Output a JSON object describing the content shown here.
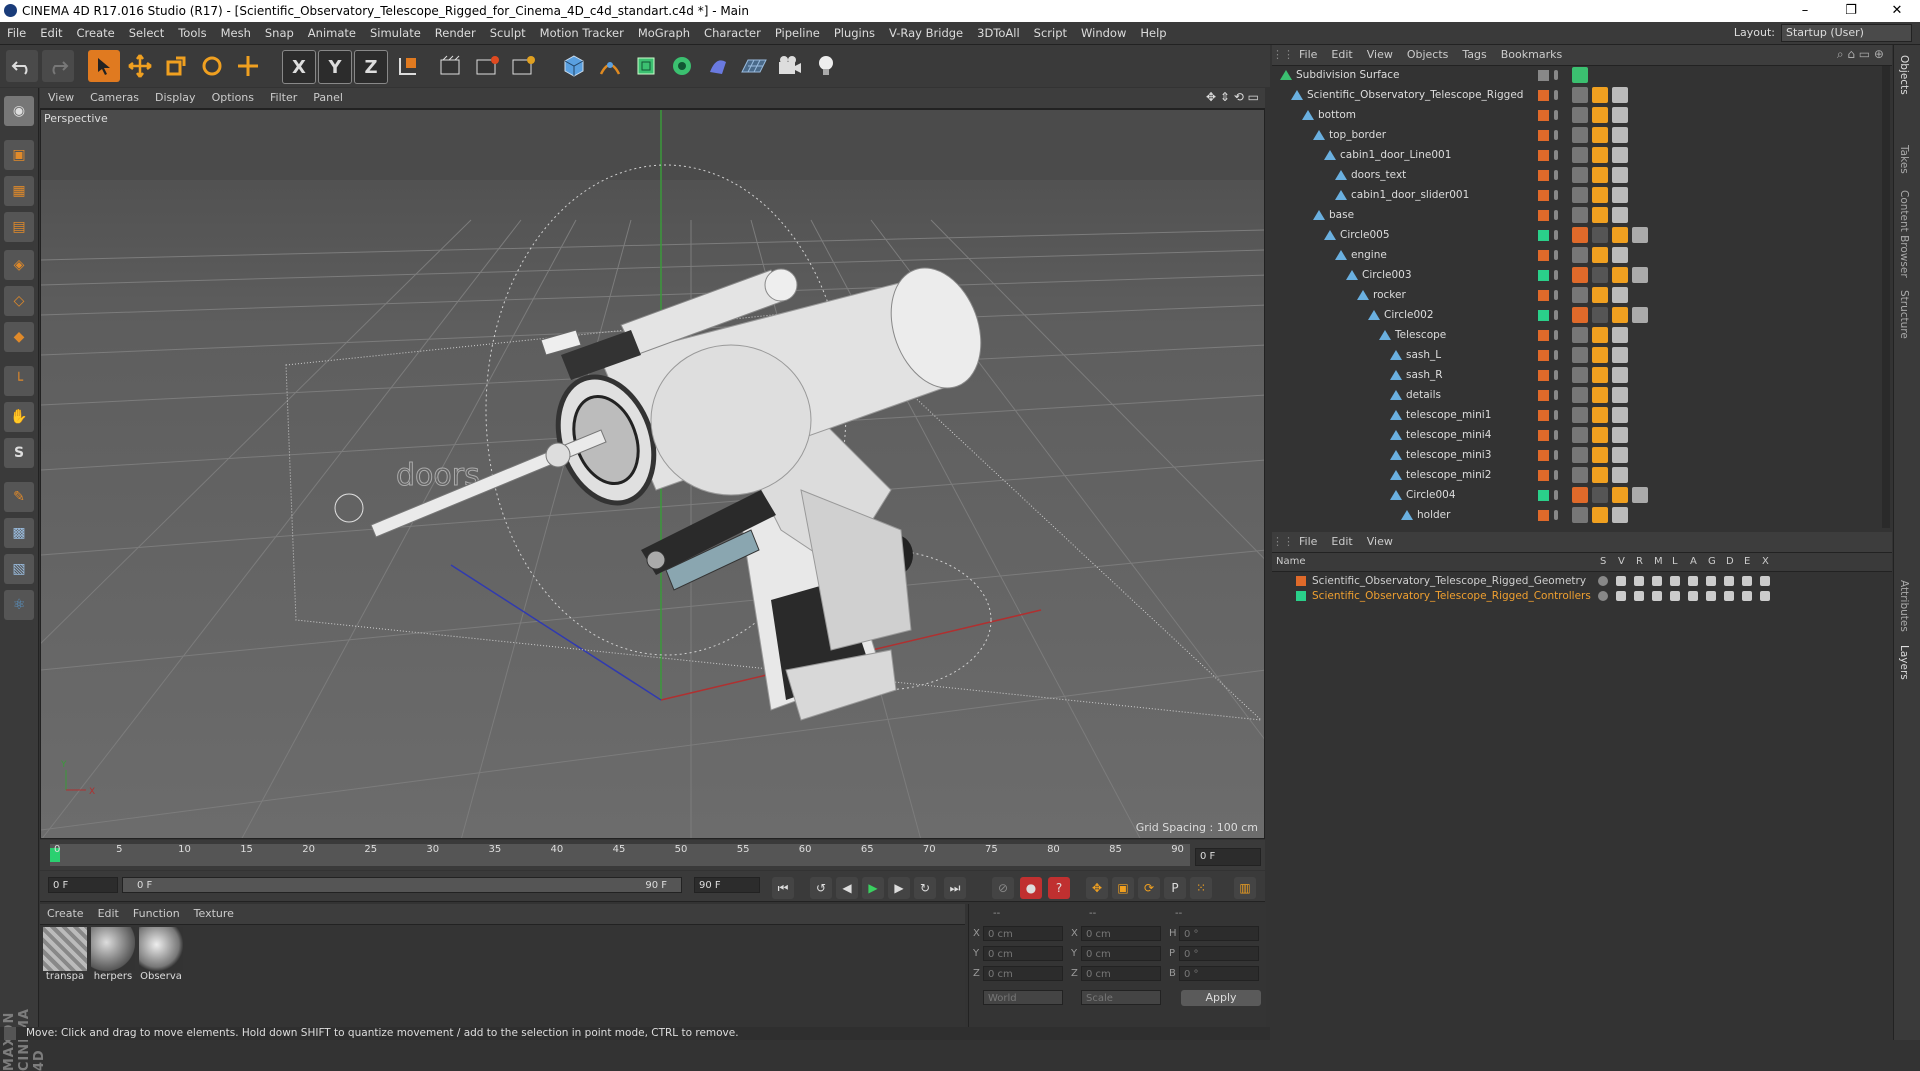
{
  "window": {
    "title": "CINEMA 4D R17.016 Studio (R17) - [Scientific_Observatory_Telescope_Rigged_for_Cinema_4D_c4d_standart.c4d *] - Main",
    "controls": [
      "–",
      "❐",
      "✕"
    ]
  },
  "menubar": {
    "items": [
      "File",
      "Edit",
      "Create",
      "Select",
      "Tools",
      "Mesh",
      "Snap",
      "Animate",
      "Simulate",
      "Render",
      "Sculpt",
      "Motion Tracker",
      "MoGraph",
      "Character",
      "Pipeline",
      "Plugins",
      "V-Ray Bridge",
      "3DToAll",
      "Script",
      "Window",
      "Help"
    ],
    "layout_label": "Layout:",
    "layout_value": "Startup (User)"
  },
  "toolbar": {
    "axis_x": "X",
    "axis_y": "Y",
    "axis_z": "Z",
    "icons": [
      "undo-icon",
      "redo-icon",
      "select-arrow-icon",
      "move-icon",
      "scale-icon",
      "rotate-icon",
      "move-alt-icon",
      "x-axis-icon",
      "y-axis-icon",
      "z-axis-icon",
      "coord-system-icon",
      "render-view-icon",
      "render-picture-icon",
      "render-settings-icon",
      "cube-icon",
      "pen-icon",
      "subdivision-icon",
      "array-icon",
      "deformer-icon",
      "floor-icon",
      "camera-icon",
      "light-icon"
    ]
  },
  "viewport": {
    "menu": [
      "View",
      "Cameras",
      "Display",
      "Options",
      "Filter",
      "Panel"
    ],
    "label": "Perspective",
    "grid_spacing": "Grid Spacing : 100 cm",
    "scene_text": "doors",
    "axis_x_label": "X",
    "axis_y_label": "Y"
  },
  "timeline": {
    "ticks": [
      "0",
      "5",
      "10",
      "15",
      "20",
      "25",
      "30",
      "35",
      "40",
      "45",
      "50",
      "55",
      "60",
      "65",
      "70",
      "75",
      "80",
      "85",
      "90"
    ],
    "current_frame": "0 F",
    "start_field": "0 F",
    "range_start": "0 F",
    "range_end": "90 F",
    "end_field": "90 F"
  },
  "materials": {
    "menu": [
      "Create",
      "Edit",
      "Function",
      "Texture"
    ],
    "items": [
      {
        "label": "transpa"
      },
      {
        "label": "herpers"
      },
      {
        "label": "Observa"
      }
    ]
  },
  "coordinates": {
    "header": [
      "--",
      "--",
      "--"
    ],
    "rows": [
      {
        "a": "X",
        "av": "0 cm",
        "b": "X",
        "bv": "0 cm",
        "c": "H",
        "cv": "0 °"
      },
      {
        "a": "Y",
        "av": "0 cm",
        "b": "Y",
        "bv": "0 cm",
        "c": "P",
        "cv": "0 °"
      },
      {
        "a": "Z",
        "av": "0 cm",
        "b": "Z",
        "bv": "0 cm",
        "c": "B",
        "cv": "0 °"
      }
    ],
    "mode1": "World",
    "mode2": "Scale",
    "apply": "Apply"
  },
  "status": "Move: Click and drag to move elements. Hold down SHIFT to quantize movement / add to the selection in point mode, CTRL to remove.",
  "objects": {
    "menu": [
      "File",
      "Edit",
      "View",
      "Objects",
      "Tags",
      "Bookmarks"
    ],
    "rows": [
      {
        "name": "Subdivision Surface",
        "depth": 0,
        "color": "#888888"
      },
      {
        "name": "Scientific_Observatory_Telescope_Rigged",
        "depth": 1,
        "color": "#e06a2a"
      },
      {
        "name": "bottom",
        "depth": 2,
        "color": "#e06a2a"
      },
      {
        "name": "top_border",
        "depth": 3,
        "color": "#e06a2a"
      },
      {
        "name": "cabin1_door_Line001",
        "depth": 4,
        "color": "#e06a2a"
      },
      {
        "name": "doors_text",
        "depth": 5,
        "color": "#e06a2a"
      },
      {
        "name": "cabin1_door_slider001",
        "depth": 5,
        "color": "#e06a2a"
      },
      {
        "name": "base",
        "depth": 3,
        "color": "#e06a2a"
      },
      {
        "name": "Circle005",
        "depth": 4,
        "color": "#2ad08a"
      },
      {
        "name": "engine",
        "depth": 5,
        "color": "#e06a2a"
      },
      {
        "name": "Circle003",
        "depth": 6,
        "color": "#2ad08a"
      },
      {
        "name": "rocker",
        "depth": 7,
        "color": "#e06a2a"
      },
      {
        "name": "Circle002",
        "depth": 8,
        "color": "#2ad08a"
      },
      {
        "name": "Telescope",
        "depth": 9,
        "color": "#e06a2a"
      },
      {
        "name": "sash_L",
        "depth": 10,
        "color": "#e06a2a"
      },
      {
        "name": "sash_R",
        "depth": 10,
        "color": "#e06a2a"
      },
      {
        "name": "details",
        "depth": 10,
        "color": "#e06a2a"
      },
      {
        "name": "telescope_mini1",
        "depth": 10,
        "color": "#e06a2a"
      },
      {
        "name": "telescope_mini4",
        "depth": 10,
        "color": "#e06a2a"
      },
      {
        "name": "telescope_mini3",
        "depth": 10,
        "color": "#e06a2a"
      },
      {
        "name": "telescope_mini2",
        "depth": 10,
        "color": "#e06a2a"
      },
      {
        "name": "Circle004",
        "depth": 10,
        "color": "#2ad08a"
      },
      {
        "name": "holder",
        "depth": 11,
        "color": "#e06a2a"
      }
    ]
  },
  "layers": {
    "menu": [
      "File",
      "Edit",
      "View"
    ],
    "headers": [
      "Name",
      "S",
      "V",
      "R",
      "M",
      "L",
      "A",
      "G",
      "D",
      "E",
      "X"
    ],
    "rows": [
      {
        "name": "Scientific_Observatory_Telescope_Rigged_Geometry",
        "color": "#e06a2a",
        "text_color": "#cfcfcf"
      },
      {
        "name": "Scientific_Observatory_Telescope_Rigged_Controllers",
        "color": "#2ad08a",
        "text_color": "#f0a030"
      }
    ]
  },
  "right_tabs": [
    "Objects",
    "Takes",
    "Content Browser",
    "Structure",
    "Attributes",
    "Layers"
  ]
}
